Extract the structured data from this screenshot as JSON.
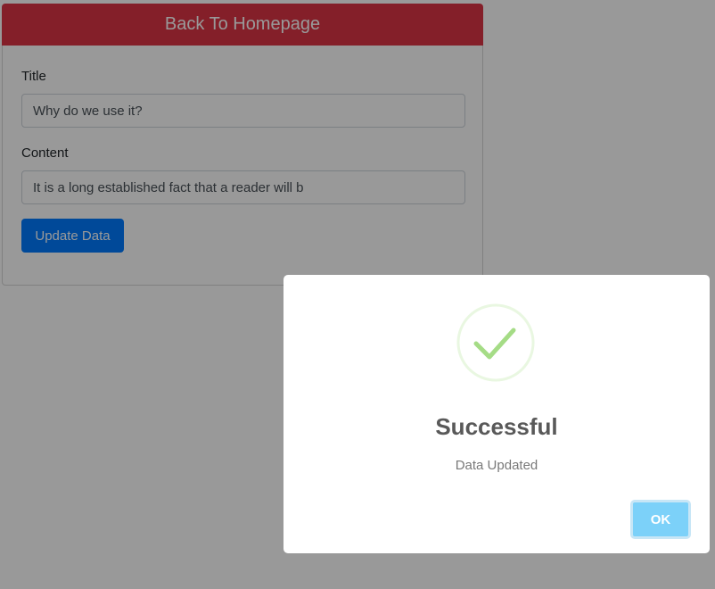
{
  "header": {
    "back_label": "Back To Homepage"
  },
  "form": {
    "title_label": "Title",
    "title_value": "Why do we use it?",
    "content_label": "Content",
    "content_value": "It is a long established fact that a reader will b",
    "submit_label": "Update Data"
  },
  "modal": {
    "icon": "checkmark-success-icon",
    "title": "Successful",
    "text": "Data Updated",
    "ok_label": "OK"
  },
  "colors": {
    "back_button": "#dc3545",
    "primary": "#007bff",
    "success": "#a5dc86",
    "ok_button": "#7cd1f9"
  }
}
